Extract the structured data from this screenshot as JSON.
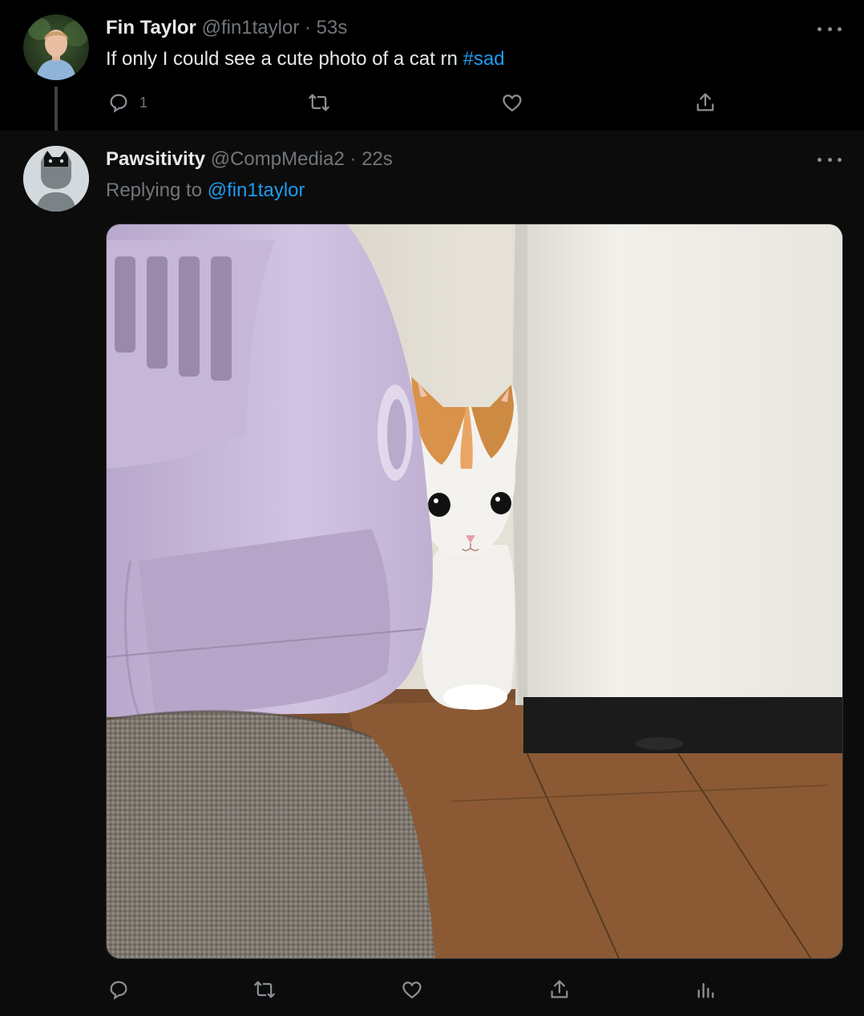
{
  "tweets": [
    {
      "name": "Fin Taylor",
      "handle": "@fin1taylor",
      "separator": "·",
      "time": "53s",
      "text": "If only I could see a cute photo of a cat rn ",
      "hashtag": "#sad",
      "reply_count": "1"
    },
    {
      "name": "Pawsitivity",
      "handle": "@CompMedia2",
      "separator": "·",
      "time": "22s",
      "replying_label": "Replying to ",
      "replying_handle": "@fin1taylor"
    }
  ],
  "icons": {
    "reply": "reply-icon",
    "retweet": "retweet-icon",
    "like": "heart-icon",
    "share": "share-icon",
    "analytics": "analytics-icon",
    "more": "more-icon"
  },
  "colors": {
    "accent": "#1d9bf0",
    "muted": "#71767b",
    "text": "#e7e9ea",
    "background": "#000000"
  }
}
